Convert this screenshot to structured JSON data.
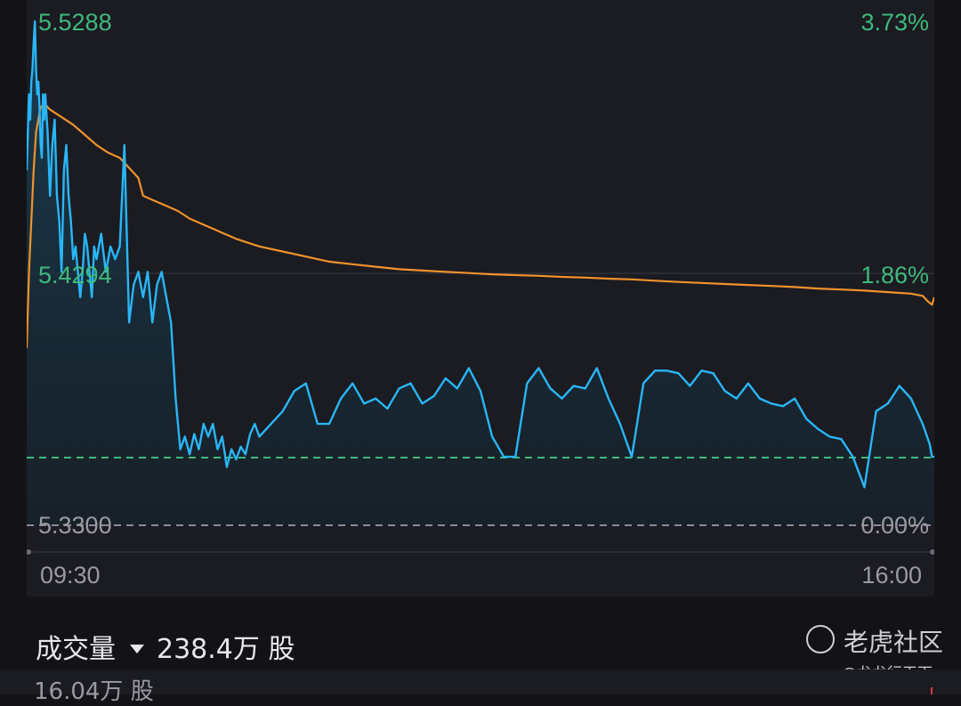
{
  "chart_data": {
    "type": "line",
    "x_axis": {
      "start_label": "09:30",
      "end_label": "16:00"
    },
    "price_range": [
      5.33,
      5.5288
    ],
    "left_labels": [
      "5.5288",
      "5.4294",
      "5.3300"
    ],
    "right_labels": [
      "3.73%",
      "1.86%",
      "0.00%"
    ],
    "previous_close": 5.33,
    "reference_line": 5.3567,
    "grid": "midline",
    "series": [
      {
        "color": "#29b6f6",
        "x": [
          0,
          1,
          1.5,
          2,
          2.5,
          3,
          3.5,
          4,
          4.5,
          5,
          5.5,
          6,
          6.5,
          7,
          7.5,
          8,
          9,
          10,
          11,
          12,
          13,
          14,
          15,
          16,
          17,
          18,
          19,
          20,
          21,
          22,
          23,
          24,
          25,
          26,
          27,
          28,
          29,
          30,
          32,
          34,
          36,
          38,
          40,
          42,
          44,
          46,
          48,
          50,
          52,
          54,
          56,
          58,
          60,
          62,
          64,
          66,
          68,
          70,
          72,
          74,
          76,
          78,
          80,
          82,
          84,
          86,
          88,
          90,
          92,
          94,
          96,
          98,
          100,
          105,
          110,
          115,
          120,
          125,
          130,
          135,
          140,
          145,
          150,
          155,
          160,
          165,
          170,
          175,
          180,
          185,
          190,
          195,
          200,
          205,
          210,
          215,
          220,
          225,
          230,
          235,
          240,
          245,
          250,
          255,
          260,
          265,
          270,
          275,
          280,
          285,
          290,
          295,
          300,
          305,
          310,
          315,
          320,
          325,
          330,
          335,
          340,
          345,
          350,
          355,
          360,
          365,
          370,
          375,
          380,
          385,
          388,
          389,
          390
        ],
        "y": [
          5.47,
          5.5,
          5.49,
          5.505,
          5.51,
          5.52,
          5.5288,
          5.51,
          5.5,
          5.505,
          5.495,
          5.48,
          5.475,
          5.5,
          5.49,
          5.5,
          5.485,
          5.46,
          5.48,
          5.49,
          5.46,
          5.45,
          5.43,
          5.47,
          5.48,
          5.46,
          5.45,
          5.435,
          5.44,
          5.43,
          5.42,
          5.43,
          5.445,
          5.44,
          5.43,
          5.42,
          5.44,
          5.435,
          5.445,
          5.43,
          5.44,
          5.435,
          5.44,
          5.48,
          5.41,
          5.425,
          5.43,
          5.42,
          5.43,
          5.41,
          5.425,
          5.43,
          5.42,
          5.41,
          5.38,
          5.36,
          5.365,
          5.358,
          5.366,
          5.36,
          5.37,
          5.365,
          5.37,
          5.36,
          5.365,
          5.353,
          5.36,
          5.356,
          5.361,
          5.358,
          5.366,
          5.37,
          5.365,
          5.37,
          5.375,
          5.383,
          5.386,
          5.37,
          5.37,
          5.38,
          5.386,
          5.378,
          5.38,
          5.376,
          5.384,
          5.386,
          5.378,
          5.381,
          5.388,
          5.384,
          5.392,
          5.383,
          5.365,
          5.357,
          5.357,
          5.386,
          5.392,
          5.384,
          5.38,
          5.385,
          5.384,
          5.392,
          5.38,
          5.37,
          5.357,
          5.386,
          5.391,
          5.391,
          5.39,
          5.385,
          5.391,
          5.39,
          5.383,
          5.38,
          5.386,
          5.38,
          5.378,
          5.377,
          5.38,
          5.372,
          5.368,
          5.365,
          5.364,
          5.357,
          5.345,
          5.375,
          5.378,
          5.385,
          5.38,
          5.37,
          5.362,
          5.357,
          5.357
        ]
      },
      {
        "color": "#f0922b",
        "x": [
          0,
          1,
          2,
          3,
          4,
          5,
          6,
          8,
          10,
          15,
          20,
          25,
          30,
          35,
          40,
          45,
          48,
          50,
          55,
          60,
          65,
          70,
          75,
          80,
          90,
          100,
          110,
          120,
          130,
          140,
          150,
          160,
          170,
          180,
          190,
          200,
          210,
          220,
          230,
          240,
          250,
          260,
          270,
          280,
          290,
          300,
          310,
          320,
          330,
          340,
          350,
          360,
          370,
          380,
          385,
          387,
          389,
          390
        ],
        "y": [
          5.4,
          5.43,
          5.45,
          5.47,
          5.485,
          5.49,
          5.495,
          5.496,
          5.494,
          5.491,
          5.488,
          5.484,
          5.48,
          5.477,
          5.475,
          5.47,
          5.467,
          5.46,
          5.458,
          5.456,
          5.454,
          5.451,
          5.449,
          5.447,
          5.443,
          5.44,
          5.438,
          5.436,
          5.434,
          5.433,
          5.432,
          5.431,
          5.4305,
          5.43,
          5.4295,
          5.429,
          5.4287,
          5.4284,
          5.428,
          5.4277,
          5.4273,
          5.427,
          5.4265,
          5.426,
          5.4256,
          5.4252,
          5.4248,
          5.4244,
          5.424,
          5.4234,
          5.423,
          5.4226,
          5.422,
          5.4214,
          5.4205,
          5.4185,
          5.417,
          5.42
        ]
      }
    ]
  },
  "volume": {
    "label": "成交量",
    "value": "238.4万",
    "unit": "股"
  },
  "bottom_volume": "16.04万 股",
  "watermark": {
    "name": "老虎社区",
    "user": "@龙龙行天下"
  },
  "colors": {
    "price_line": "#29b6f6",
    "average_line": "#f0922b",
    "label_green": "#3fb97c",
    "dashed_green": "#3fb97c",
    "dashed_gray": "#8a8a96",
    "background": "#131317",
    "panel": "#1b1b22"
  }
}
